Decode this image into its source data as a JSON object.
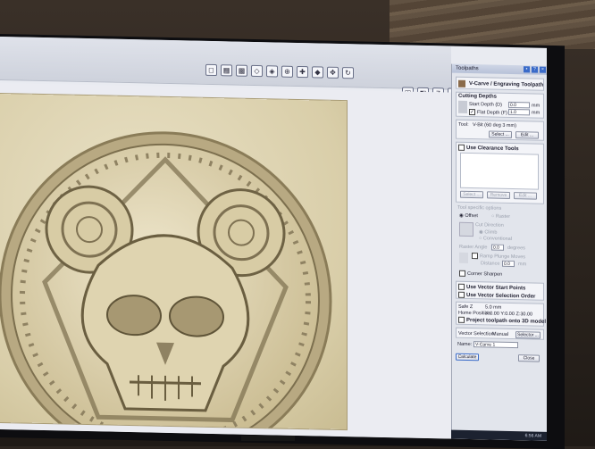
{
  "toolbar": {
    "icons": [
      "zoom-extents-icon",
      "grid-icon",
      "grid-snap-icon",
      "node-edit-icon",
      "zoom-in-icon",
      "zoom-box-icon",
      "pan-icon",
      "measure-icon",
      "move-icon",
      "rotate-icon"
    ],
    "view_icons": [
      "iso-view-icon",
      "left-view-icon",
      "z-view-icon",
      "y-view-icon",
      "x-view-icon"
    ]
  },
  "panel": {
    "title": "Toolpaths",
    "toolpath_type": "V-Carve / Engraving Toolpath",
    "cutting_depths_header": "Cutting Depths",
    "start_depth_label": "Start Depth (D)",
    "start_depth_value": "0.0",
    "flat_depth_label": "Flat Depth (F)",
    "flat_depth_value": "1.0",
    "unit": "mm",
    "tool_label": "Tool:",
    "tool_value": "V-Bit (60 deg 3 mm)",
    "select_button": "Select ...",
    "edit_button": "Edit ...",
    "clearance_label": "Use Clearance Tools",
    "clearance_buttons": [
      "Select ...",
      "Remove",
      "Edit ..."
    ],
    "tool_specific_options": "Tool specific options",
    "offset_label": "Offset",
    "raster_label": "Raster",
    "cut_direction_label": "Cut Direction",
    "climb_label": "Climb",
    "conventional_label": "Conventional",
    "raster_angle_label": "Raster Angle",
    "raster_angle_value": "0.0",
    "raster_angle_unit": "degrees",
    "ramp_label": "Ramp Plunge Moves",
    "distance_label": "Distance",
    "distance_value": "0.0",
    "corner_sharpen_label": "Corner Sharpen",
    "vector_start_label": "Use Vector Start Points",
    "vector_selection_order_label": "Use Vector Selection Order",
    "safe_z_label": "Safe Z",
    "safe_z_value": "5.0 mm",
    "home_position_label": "Home Position",
    "home_position_value": "X:0.00 Y:0.00 Z:30.00",
    "project_label": "Project toolpath onto 3D model",
    "vector_selection_label": "Vector Selection:",
    "vector_selection_value": "Manual",
    "selector_button": "Selector ...",
    "name_label": "Name:",
    "name_value": "V-Carve 1",
    "calculate_button": "Calculate",
    "close_button": "Close"
  },
  "taskbar": {
    "time": "6:56 AM"
  }
}
